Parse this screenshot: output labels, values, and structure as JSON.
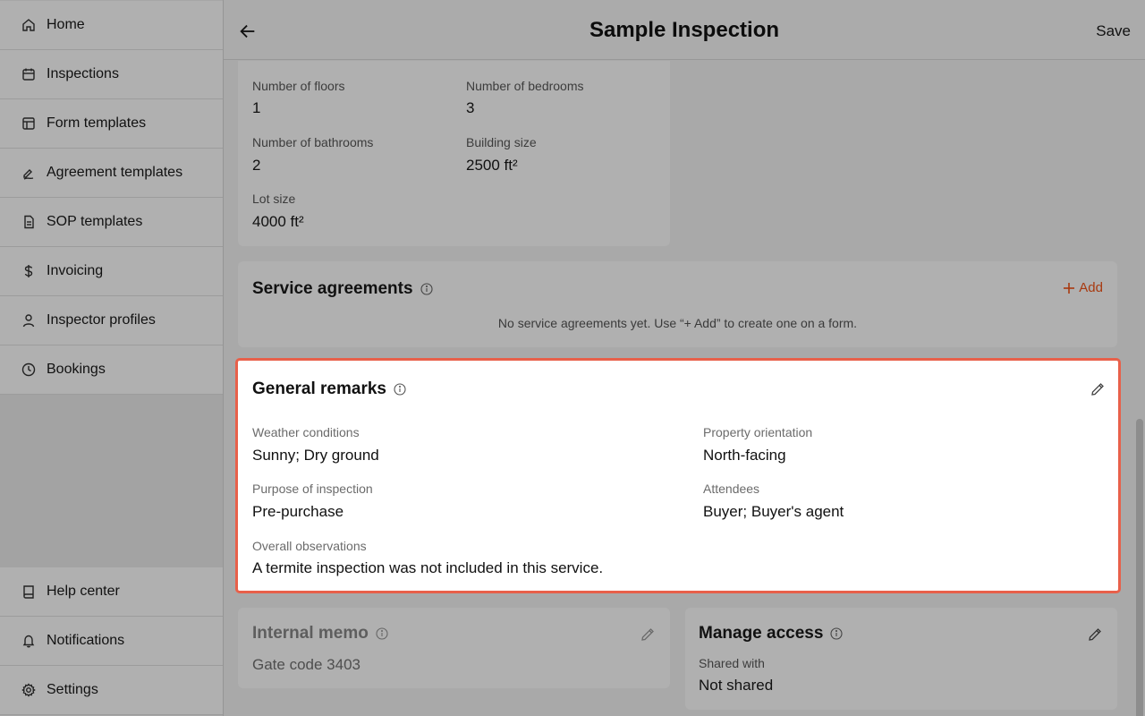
{
  "sidebar": {
    "items": [
      {
        "label": "Home",
        "icon": "home-icon"
      },
      {
        "label": "Inspections",
        "icon": "calendar-icon"
      },
      {
        "label": "Form templates",
        "icon": "layout-icon"
      },
      {
        "label": "Agreement templates",
        "icon": "signature-icon"
      },
      {
        "label": "SOP templates",
        "icon": "document-icon"
      },
      {
        "label": "Invoicing",
        "icon": "dollar-icon"
      },
      {
        "label": "Inspector profiles",
        "icon": "user-icon"
      },
      {
        "label": "Bookings",
        "icon": "clock-icon"
      }
    ],
    "bottom_items": [
      {
        "label": "Help center",
        "icon": "book-icon"
      },
      {
        "label": "Notifications",
        "icon": "bell-icon"
      },
      {
        "label": "Settings",
        "icon": "gear-icon"
      }
    ]
  },
  "header": {
    "title": "Sample Inspection",
    "save_label": "Save"
  },
  "property": {
    "floors_label": "Number of floors",
    "floors_value": "1",
    "bedrooms_label": "Number of bedrooms",
    "bedrooms_value": "3",
    "bathrooms_label": "Number of bathrooms",
    "bathrooms_value": "2",
    "building_label": "Building size",
    "building_value": "2500 ft²",
    "lot_label": "Lot size",
    "lot_value": "4000 ft²"
  },
  "service_agreements": {
    "title": "Service agreements",
    "add_label": "Add",
    "empty_text": "No service agreements yet. Use “+ Add” to create one on a form."
  },
  "general_remarks": {
    "title": "General remarks",
    "weather_label": "Weather conditions",
    "weather_value": "Sunny; Dry ground",
    "orientation_label": "Property orientation",
    "orientation_value": "North-facing",
    "purpose_label": "Purpose of inspection",
    "purpose_value": "Pre-purchase",
    "attendees_label": "Attendees",
    "attendees_value": "Buyer; Buyer's agent",
    "observations_label": "Overall observations",
    "observations_value": "A termite inspection was not included in this service."
  },
  "internal_memo": {
    "title": "Internal memo",
    "value": "Gate code 3403"
  },
  "manage_access": {
    "title": "Manage access",
    "shared_label": "Shared with",
    "shared_value": "Not shared"
  },
  "colors": {
    "highlight_border": "#e8604a",
    "add_accent": "#a8390f"
  }
}
